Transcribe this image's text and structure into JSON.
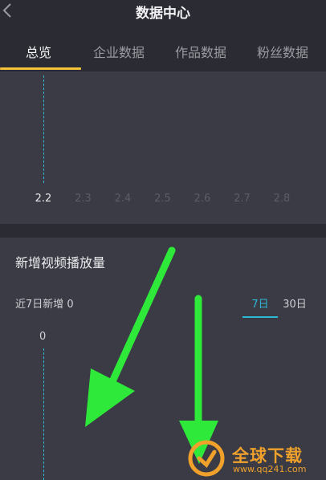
{
  "header": {
    "title": "数据中心",
    "back_icon": "chevron-left-icon"
  },
  "tabs": [
    {
      "label": "总览",
      "active": true
    },
    {
      "label": "企业数据",
      "active": false
    },
    {
      "label": "作品数据",
      "active": false
    },
    {
      "label": "粉丝数据",
      "active": false
    }
  ],
  "overview_chart": {
    "x_labels": [
      "2.2",
      "2.3",
      "2.4",
      "2.5",
      "2.6",
      "2.7",
      "2.8"
    ],
    "selected_label": "2.2"
  },
  "play_section": {
    "title": "新增视频播放量",
    "summary": "近7日新增 0",
    "periods": [
      "7日",
      "30日"
    ],
    "selected_period": "7日",
    "y_value": "0"
  },
  "watermark": {
    "text": "全球下载",
    "url": "www.qq241.com"
  },
  "colors": {
    "background": "#2b2c33",
    "card": "#3a3b44",
    "accent": "#2fb8d6",
    "tab_indicator": "#f3c23a",
    "annotation_arrow": "#2ee83a",
    "watermark": "#f0a12c"
  }
}
